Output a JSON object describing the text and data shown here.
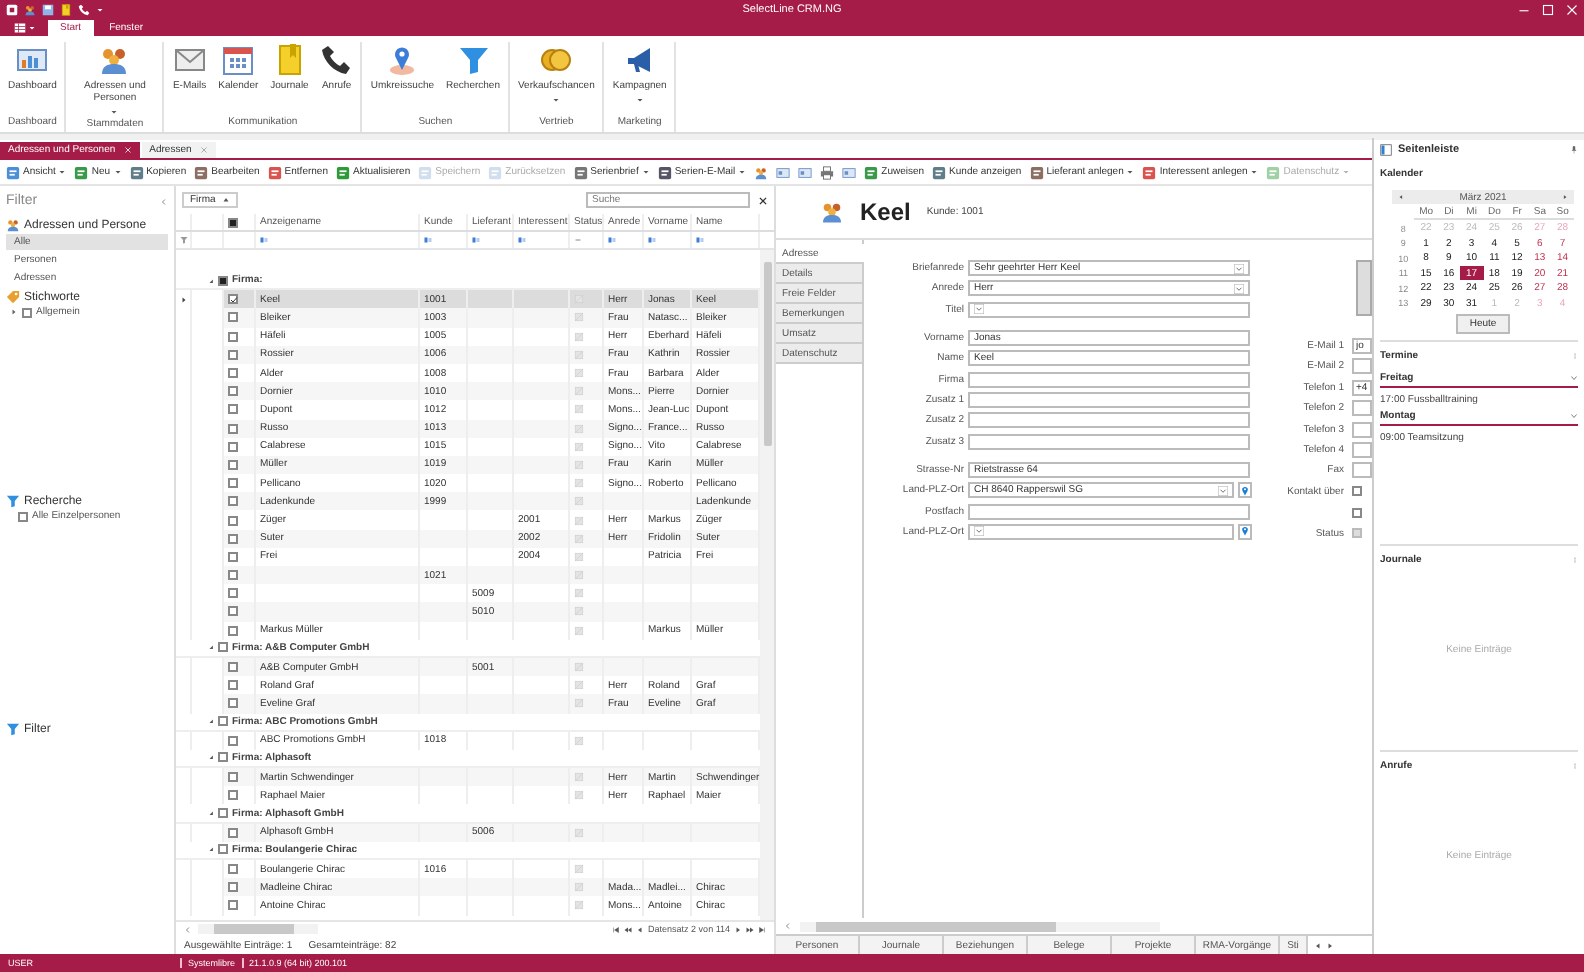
{
  "window": {
    "title": "SelectLine CRM.NG"
  },
  "ribbon_tabs": [
    {
      "label": "Start",
      "selected": true
    },
    {
      "label": "Fenster",
      "selected": false
    }
  ],
  "ribbon_groups": [
    {
      "label": "Dashboard",
      "buttons": [
        {
          "label": "Dashboard",
          "dropdown": false
        }
      ]
    },
    {
      "label": "Stammdaten",
      "buttons": [
        {
          "label": "Adressen und Personen",
          "dropdown": true
        }
      ]
    },
    {
      "label": "Kommunikation",
      "buttons": [
        {
          "label": "E-Mails",
          "dropdown": false
        },
        {
          "label": "Kalender",
          "dropdown": false
        },
        {
          "label": "Journale",
          "dropdown": false
        },
        {
          "label": "Anrufe",
          "dropdown": false
        }
      ]
    },
    {
      "label": "Suchen",
      "buttons": [
        {
          "label": "Umkreissuche",
          "dropdown": false
        },
        {
          "label": "Recherchen",
          "dropdown": false
        }
      ]
    },
    {
      "label": "Vertrieb",
      "buttons": [
        {
          "label": "Verkaufschancen",
          "dropdown": true
        }
      ]
    },
    {
      "label": "Marketing",
      "buttons": [
        {
          "label": "Kampagnen",
          "dropdown": true
        }
      ]
    }
  ],
  "doc_tabs": [
    {
      "label": "Adressen und Personen",
      "selected": true
    },
    {
      "label": "Adressen",
      "selected": false
    }
  ],
  "toolbar": [
    {
      "kind": "button",
      "label": "Ansicht",
      "dropdown": true,
      "disabled": false
    },
    {
      "kind": "button",
      "label": "Neu",
      "dropdown": true,
      "disabled": false
    },
    {
      "kind": "button",
      "label": "Kopieren",
      "dropdown": false,
      "disabled": false
    },
    {
      "kind": "button",
      "label": "Bearbeiten",
      "dropdown": false,
      "disabled": false
    },
    {
      "kind": "button",
      "label": "Entfernen",
      "dropdown": false,
      "disabled": false
    },
    {
      "kind": "button",
      "label": "Aktualisieren",
      "dropdown": false,
      "disabled": false
    },
    {
      "kind": "button",
      "label": "Speichern",
      "dropdown": false,
      "disabled": true
    },
    {
      "kind": "button",
      "label": "Zurücksetzen",
      "dropdown": false,
      "disabled": true
    },
    {
      "kind": "button",
      "label": "Serienbrief",
      "dropdown": true,
      "disabled": false
    },
    {
      "kind": "button",
      "label": "Serien-E-Mail",
      "dropdown": true,
      "disabled": false
    },
    {
      "kind": "icons"
    },
    {
      "kind": "button",
      "label": "Zuweisen",
      "dropdown": false,
      "disabled": false
    },
    {
      "kind": "button",
      "label": "Kunde anzeigen",
      "dropdown": false,
      "disabled": false
    },
    {
      "kind": "button",
      "label": "Lieferant anlegen",
      "dropdown": true,
      "disabled": false
    },
    {
      "kind": "button",
      "label": "Interessent anlegen",
      "dropdown": true,
      "disabled": false
    },
    {
      "kind": "button",
      "label": "Datenschutz",
      "dropdown": true,
      "disabled": true
    }
  ],
  "filter_panel": {
    "title": "Filter",
    "sections": [
      {
        "kind": "list",
        "title": "Adressen und Persone",
        "items": [
          {
            "label": "Alle",
            "selected": true
          },
          {
            "label": "Personen",
            "selected": false
          },
          {
            "label": "Adressen",
            "selected": false
          }
        ]
      },
      {
        "kind": "tree",
        "title": "Stichworte",
        "items": [
          {
            "label": "Allgemein",
            "checked": false,
            "expanded": false
          }
        ]
      },
      {
        "kind": "checks",
        "title": "Recherche",
        "items": [
          {
            "label": "Alle Einzelpersonen",
            "checked": false
          }
        ]
      },
      {
        "kind": "filter",
        "title": "Filter"
      }
    ]
  },
  "grid": {
    "sort_chip": {
      "label": "Firma",
      "ascending": true
    },
    "select_all_partial": true,
    "search_placeholder": "Suche",
    "columns": [
      "Anzeigename",
      "Kunde",
      "Lieferant",
      "Interessent",
      "Status",
      "Anrede",
      "Vorname",
      "Name"
    ],
    "groups": [
      {
        "label": "Firma:",
        "partial": true,
        "rows": [
          {
            "checked": true,
            "selected": true,
            "display_name": "Keel",
            "customer": "1001",
            "salutation": "Herr",
            "first_name": "Jonas",
            "last_name": "Keel"
          },
          {
            "checked": false,
            "selected": false,
            "display_name": "Bleiker",
            "customer": "1003",
            "salutation": "Frau",
            "first_name": "Natasc...",
            "last_name": "Bleiker"
          },
          {
            "checked": false,
            "selected": false,
            "display_name": "Häfeli",
            "customer": "1005",
            "salutation": "Herr",
            "first_name": "Eberhard",
            "last_name": "Häfeli"
          },
          {
            "checked": false,
            "selected": false,
            "display_name": "Rossier",
            "customer": "1006",
            "salutation": "Frau",
            "first_name": "Kathrin",
            "last_name": "Rossier"
          },
          {
            "checked": false,
            "selected": false,
            "display_name": "Alder",
            "customer": "1008",
            "salutation": "Frau",
            "first_name": "Barbara",
            "last_name": "Alder"
          },
          {
            "checked": false,
            "selected": false,
            "display_name": "Dornier",
            "customer": "1010",
            "salutation": "Mons...",
            "first_name": "Pierre",
            "last_name": "Dornier"
          },
          {
            "checked": false,
            "selected": false,
            "display_name": "Dupont",
            "customer": "1012",
            "salutation": "Mons...",
            "first_name": "Jean-Luc",
            "last_name": "Dupont"
          },
          {
            "checked": false,
            "selected": false,
            "display_name": "Russo",
            "customer": "1013",
            "salutation": "Signo...",
            "first_name": "France...",
            "last_name": "Russo"
          },
          {
            "checked": false,
            "selected": false,
            "display_name": "Calabrese",
            "customer": "1015",
            "salutation": "Signo...",
            "first_name": "Vito",
            "last_name": "Calabrese"
          },
          {
            "checked": false,
            "selected": false,
            "display_name": "Müller",
            "customer": "1019",
            "salutation": "Frau",
            "first_name": "Karin",
            "last_name": "Müller"
          },
          {
            "checked": false,
            "selected": false,
            "display_name": "Pellicano",
            "customer": "1020",
            "salutation": "Signo...",
            "first_name": "Roberto",
            "last_name": "Pellicano"
          },
          {
            "checked": false,
            "selected": false,
            "display_name": "Ladenkunde",
            "customer": "1999",
            "last_name": "Ladenkunde"
          },
          {
            "checked": false,
            "selected": false,
            "display_name": "Züger",
            "prospect": "2001",
            "salutation": "Herr",
            "first_name": "Markus",
            "last_name": "Züger"
          },
          {
            "checked": false,
            "selected": false,
            "display_name": "Suter",
            "prospect": "2002",
            "salutation": "Herr",
            "first_name": "Fridolin",
            "last_name": "Suter"
          },
          {
            "checked": false,
            "selected": false,
            "display_name": "Frei",
            "prospect": "2004",
            "first_name": "Patricia",
            "last_name": "Frei"
          },
          {
            "checked": false,
            "selected": false,
            "customer": "1021"
          },
          {
            "checked": false,
            "selected": false,
            "supplier": "5009"
          },
          {
            "checked": false,
            "selected": false,
            "supplier": "5010"
          },
          {
            "checked": false,
            "selected": false,
            "display_name": "Markus Müller",
            "first_name": "Markus",
            "last_name": "Müller"
          }
        ]
      },
      {
        "label": "Firma: A&B Computer GmbH",
        "partial": false,
        "rows": [
          {
            "checked": false,
            "selected": false,
            "display_name": "A&B Computer GmbH",
            "supplier": "5001"
          },
          {
            "checked": false,
            "selected": false,
            "display_name": "Roland Graf",
            "salutation": "Herr",
            "first_name": "Roland",
            "last_name": "Graf"
          },
          {
            "checked": false,
            "selected": false,
            "display_name": "Eveline Graf",
            "salutation": "Frau",
            "first_name": "Eveline",
            "last_name": "Graf"
          }
        ]
      },
      {
        "label": "Firma: ABC Promotions GmbH",
        "partial": false,
        "rows": [
          {
            "checked": false,
            "selected": false,
            "display_name": "ABC Promotions GmbH",
            "customer": "1018"
          }
        ]
      },
      {
        "label": "Firma: Alphasoft",
        "partial": false,
        "rows": [
          {
            "checked": false,
            "selected": false,
            "display_name": "Martin Schwendinger",
            "salutation": "Herr",
            "first_name": "Martin",
            "last_name": "Schwendinger"
          },
          {
            "checked": false,
            "selected": false,
            "display_name": "Raphael Maier",
            "salutation": "Herr",
            "first_name": "Raphael",
            "last_name": "Maier"
          }
        ]
      },
      {
        "label": "Firma: Alphasoft GmbH",
        "partial": false,
        "rows": [
          {
            "checked": false,
            "selected": false,
            "display_name": "Alphasoft GmbH",
            "supplier": "5006"
          }
        ]
      },
      {
        "label": "Firma: Boulangerie Chirac",
        "partial": false,
        "rows": [
          {
            "checked": false,
            "selected": false,
            "display_name": "Boulangerie Chirac",
            "customer": "1016"
          },
          {
            "checked": false,
            "selected": false,
            "display_name": "Madleine Chirac",
            "salutation": "Mada...",
            "first_name": "Madlei...",
            "last_name": "Chirac"
          },
          {
            "checked": false,
            "selected": false,
            "display_name": "Antoine Chirac",
            "salutation": "Mons...",
            "first_name": "Antoine",
            "last_name": "Chirac"
          }
        ]
      }
    ],
    "pager": "Datensatz 2 von 114",
    "footer": [
      "Ausgewählte Einträge: 1",
      "Gesamteinträge: 82"
    ]
  },
  "detail": {
    "title": "Keel",
    "subtitle": "Kunde: 1001",
    "tabs": [
      {
        "label": "Adresse",
        "selected": true
      },
      {
        "label": "Details",
        "selected": false
      },
      {
        "label": "Freie Felder",
        "selected": false
      },
      {
        "label": "Bemerkungen",
        "selected": false
      },
      {
        "label": "Umsatz",
        "selected": false
      },
      {
        "label": "Datenschutz",
        "selected": false
      }
    ],
    "field_groups": [
      [
        {
          "kind": "select",
          "label": "Briefanrede",
          "value": "Sehr geehrter Herr Keel"
        },
        {
          "kind": "select",
          "label": "Anrede",
          "value": "Herr"
        },
        {
          "kind": "select",
          "label": "Titel"
        }
      ],
      [
        {
          "kind": "text",
          "label": "Vorname",
          "value": "Jonas"
        },
        {
          "kind": "text",
          "label": "Name",
          "value": "Keel"
        },
        {
          "kind": "text",
          "label": "Firma"
        },
        {
          "kind": "text",
          "label": "Zusatz 1"
        },
        {
          "kind": "text",
          "label": "Zusatz 2"
        },
        {
          "kind": "text",
          "label": "Zusatz 3"
        }
      ],
      [
        {
          "kind": "text",
          "label": "Strasse-Nr",
          "value": "Rietstrasse 64"
        },
        {
          "kind": "location",
          "label": "Land-PLZ-Ort",
          "value": "CH 8640 Rapperswil SG"
        },
        {
          "kind": "text",
          "label": "Postfach"
        },
        {
          "kind": "location",
          "label": "Land-PLZ-Ort"
        }
      ]
    ],
    "side_fields": [
      {
        "kind": "text",
        "label": "E-Mail 1",
        "value": "jo"
      },
      {
        "kind": "text",
        "label": "E-Mail 2"
      },
      {
        "kind": "text",
        "label": "Telefon 1",
        "value": "+4"
      },
      {
        "kind": "text",
        "label": "Telefon 2"
      },
      {
        "kind": "text",
        "label": "Telefon 3"
      },
      {
        "kind": "text",
        "label": "Telefon 4"
      },
      {
        "kind": "text",
        "label": "Fax"
      },
      {
        "kind": "check",
        "label": "Kontakt über",
        "checked": false
      },
      {
        "kind": "check",
        "checked": false
      },
      {
        "kind": "status",
        "label": "Status"
      }
    ],
    "bottom_tabs": [
      {
        "label": "Personen",
        "selected": false
      },
      {
        "label": "Journale",
        "selected": false
      },
      {
        "label": "Beziehungen",
        "selected": false
      },
      {
        "label": "Belege",
        "selected": false
      },
      {
        "label": "Projekte",
        "selected": false
      },
      {
        "label": "RMA-Vorgänge",
        "selected": false
      },
      {
        "label": "Sti",
        "selected": false
      }
    ]
  },
  "sidebar": {
    "title": "Seitenleiste",
    "calendar": {
      "title": "Kalender",
      "month": "März 2021",
      "weekdays": [
        "Mo",
        "Di",
        "Mi",
        "Do",
        "Fr",
        "Sa",
        "So"
      ],
      "weeks": [
        {
          "number": "8",
          "days": [
            {
              "label": "22",
              "muted": true,
              "selected": false
            },
            {
              "label": "23",
              "muted": true,
              "selected": false
            },
            {
              "label": "24",
              "muted": true,
              "selected": false
            },
            {
              "label": "25",
              "muted": true,
              "selected": false
            },
            {
              "label": "26",
              "muted": true,
              "selected": false
            },
            {
              "label": "27",
              "muted": true,
              "selected": false
            },
            {
              "label": "28",
              "muted": true,
              "selected": false
            }
          ]
        },
        {
          "number": "9",
          "days": [
            {
              "label": "1",
              "muted": false,
              "selected": false
            },
            {
              "label": "2",
              "muted": false,
              "selected": false
            },
            {
              "label": "3",
              "muted": false,
              "selected": false
            },
            {
              "label": "4",
              "muted": false,
              "selected": false
            },
            {
              "label": "5",
              "muted": false,
              "selected": false
            },
            {
              "label": "6",
              "muted": false,
              "selected": false
            },
            {
              "label": "7",
              "muted": false,
              "selected": false
            }
          ]
        },
        {
          "number": "10",
          "days": [
            {
              "label": "8",
              "muted": false,
              "selected": false
            },
            {
              "label": "9",
              "muted": false,
              "selected": false
            },
            {
              "label": "10",
              "muted": false,
              "selected": false
            },
            {
              "label": "11",
              "muted": false,
              "selected": false
            },
            {
              "label": "12",
              "muted": false,
              "selected": false
            },
            {
              "label": "13",
              "muted": false,
              "selected": false
            },
            {
              "label": "14",
              "muted": false,
              "selected": false
            }
          ]
        },
        {
          "number": "11",
          "days": [
            {
              "label": "15",
              "muted": false,
              "selected": false
            },
            {
              "label": "16",
              "muted": false,
              "selected": false
            },
            {
              "label": "17",
              "muted": false,
              "selected": true
            },
            {
              "label": "18",
              "muted": false,
              "selected": false
            },
            {
              "label": "19",
              "muted": false,
              "selected": false
            },
            {
              "label": "20",
              "muted": false,
              "selected": false
            },
            {
              "label": "21",
              "muted": false,
              "selected": false
            }
          ]
        },
        {
          "number": "12",
          "days": [
            {
              "label": "22",
              "muted": false,
              "selected": false
            },
            {
              "label": "23",
              "muted": false,
              "selected": false
            },
            {
              "label": "24",
              "muted": false,
              "selected": false
            },
            {
              "label": "25",
              "muted": false,
              "selected": false
            },
            {
              "label": "26",
              "muted": false,
              "selected": false
            },
            {
              "label": "27",
              "muted": false,
              "selected": false
            },
            {
              "label": "28",
              "muted": false,
              "selected": false
            }
          ]
        },
        {
          "number": "13",
          "days": [
            {
              "label": "29",
              "muted": false,
              "selected": false
            },
            {
              "label": "30",
              "muted": false,
              "selected": false
            },
            {
              "label": "31",
              "muted": false,
              "selected": false
            },
            {
              "label": "1",
              "muted": true,
              "selected": false
            },
            {
              "label": "2",
              "muted": true,
              "selected": false
            },
            {
              "label": "3",
              "muted": true,
              "selected": false
            },
            {
              "label": "4",
              "muted": true,
              "selected": false
            }
          ]
        }
      ],
      "today_button": "Heute"
    },
    "sections": [
      {
        "kind": "agenda",
        "title": "Termine",
        "days": [
          {
            "label": "Freitag",
            "expanded": true,
            "entries": [
              "17:00 Fussballtraining"
            ]
          },
          {
            "label": "Montag",
            "expanded": true,
            "entries": [
              "09:00 Teamsitzung"
            ]
          }
        ]
      },
      {
        "kind": "empty",
        "title": "Journale",
        "message": "Keine Einträge"
      },
      {
        "kind": "empty",
        "title": "Anrufe",
        "message": "Keine Einträge"
      }
    ]
  },
  "status_bar": [
    "USER",
    "Systemlibre",
    "21.1.0.9 (64 bit) 200.101"
  ]
}
